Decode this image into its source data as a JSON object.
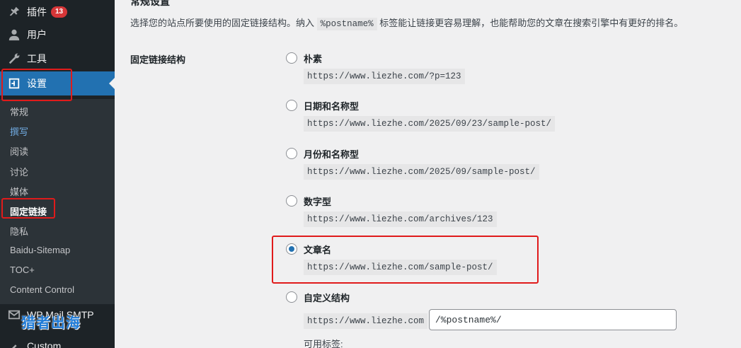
{
  "sidebar": {
    "top_items": [
      {
        "label": "插件",
        "badge": "13",
        "icon": "plugins-icon"
      },
      {
        "label": "用户",
        "icon": "users-icon"
      },
      {
        "label": "工具",
        "icon": "tools-icon"
      },
      {
        "label": "设置",
        "icon": "settings-icon"
      }
    ],
    "submenu": [
      "常规",
      "撰写",
      "阅读",
      "讨论",
      "媒体",
      "固定链接",
      "隐私",
      "Baidu-Sitemap",
      "TOC+",
      "Content Control"
    ],
    "bottom_items": [
      {
        "label": "WP Mail SMTP",
        "icon": "mail-icon"
      },
      {
        "label": "Custom",
        "icon": "custom-icon"
      }
    ],
    "watermark": "猎者出海"
  },
  "main": {
    "section_heading": "常规设置",
    "description_before": "选择您的站点所要使用的固定链接结构。纳入 ",
    "description_tag": "%postname%",
    "description_after": " 标签能让链接更容易理解，也能帮助您的文章在搜索引擎中有更好的排名。",
    "row_label": "固定链接结构",
    "options": [
      {
        "label": "朴素",
        "example": "https://www.liezhe.com/?p=123",
        "checked": false
      },
      {
        "label": "日期和名称型",
        "example": "https://www.liezhe.com/2025/09/23/sample-post/",
        "checked": false
      },
      {
        "label": "月份和名称型",
        "example": "https://www.liezhe.com/2025/09/sample-post/",
        "checked": false
      },
      {
        "label": "数字型",
        "example": "https://www.liezhe.com/archives/123",
        "checked": false
      },
      {
        "label": "文章名",
        "example": "https://www.liezhe.com/sample-post/",
        "checked": true
      },
      {
        "label": "自定义结构",
        "example": "https://www.liezhe.com",
        "checked": false
      }
    ],
    "custom_value": "/%postname%/",
    "available_tags_label": "可用标签:"
  },
  "colors": {
    "accent": "#2271b1",
    "sidebar_bg": "#1d2327",
    "highlight_box": "#e01b1b",
    "badge": "#d63638"
  }
}
